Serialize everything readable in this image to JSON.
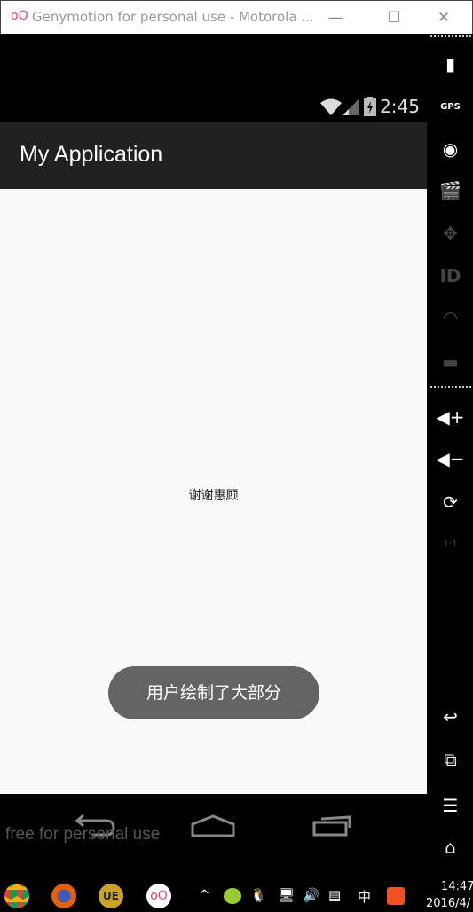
{
  "window": {
    "title": "Genymotion for personal use - Motorola ...",
    "logo": "oO",
    "minimize": "—",
    "maximize": "☐",
    "close": "✕"
  },
  "status_bar": {
    "time": "2:45",
    "icons": [
      "wifi-icon",
      "signal-icon",
      "battery-charging-icon"
    ]
  },
  "app": {
    "title": "My Application",
    "center_text": "谢谢惠顾",
    "toast": "用户绘制了大部分"
  },
  "nav_bar": {
    "icons": [
      "back-icon",
      "home-icon",
      "recents-icon"
    ]
  },
  "watermark": "free for personal use",
  "side_toolbar": {
    "gps_label": "GPS",
    "id_label": "ID",
    "scale_label": "1:1"
  },
  "taskbar": {
    "ime": "中",
    "time": "14:47",
    "date": "2016/4/"
  }
}
